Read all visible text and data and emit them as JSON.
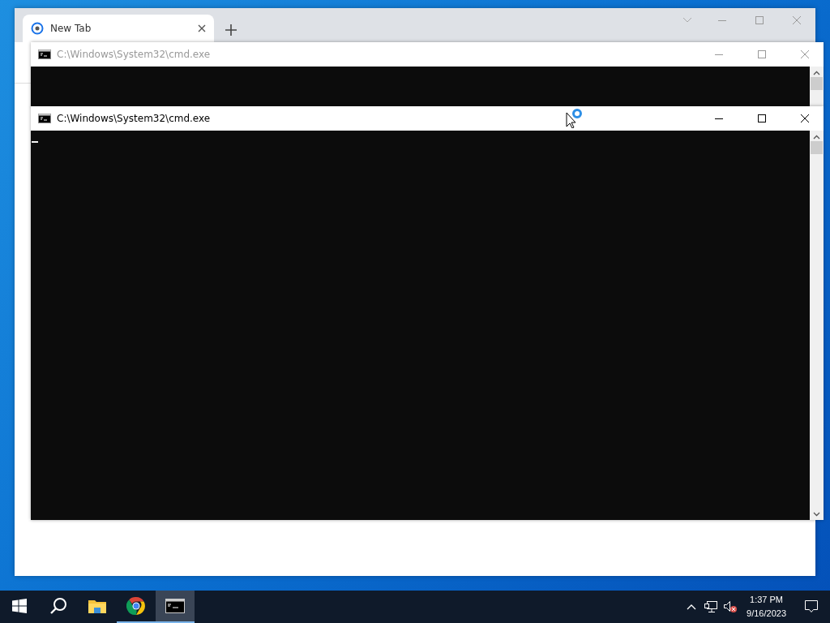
{
  "browser": {
    "tabs": [
      {
        "label": "New Tab",
        "selected": true
      }
    ]
  },
  "windows": [
    {
      "title": "C:\\Windows\\System32\\cmd.exe",
      "active": false
    },
    {
      "title": "C:\\Windows\\System32\\cmd.exe",
      "active": true
    }
  ],
  "taskbar": {
    "apps": [
      {
        "kind": "explorer",
        "running": false,
        "selected": false
      },
      {
        "kind": "chrome",
        "running": true,
        "selected": false
      },
      {
        "kind": "cmd",
        "running": true,
        "selected": true
      }
    ],
    "time": "1:37 PM",
    "date": "9/16/2023"
  }
}
